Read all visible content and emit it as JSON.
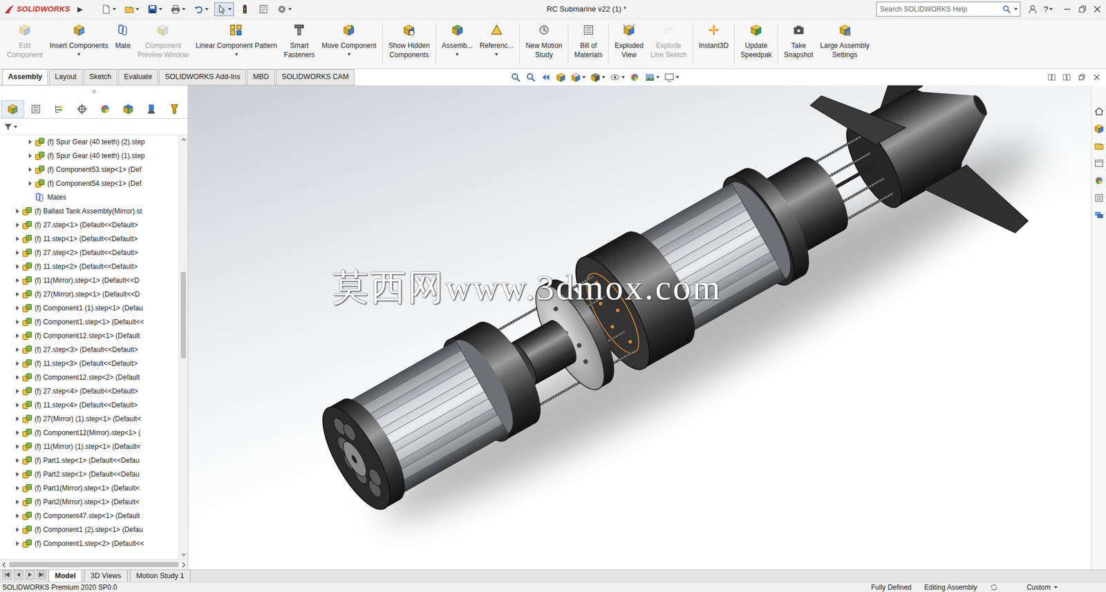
{
  "window": {
    "title": "RC Submarine v22 (1) *",
    "app": "SOLIDWORKS"
  },
  "title_bar": {
    "menu_arrow": "▶",
    "quick_access": [
      {
        "pressed": false
      },
      {
        "pressed": false
      },
      {
        "pressed": false
      },
      {
        "pressed": false
      },
      {
        "pressed": false
      },
      {
        "pressed": true
      },
      {
        "pressed": false
      },
      {
        "pressed": false
      },
      {
        "pressed": false
      }
    ],
    "search": {
      "placeholder": "Search SOLIDWORKS Help"
    },
    "help": "?"
  },
  "ribbon": [
    {
      "lines": [
        "Edit",
        "Component"
      ],
      "disabled": true,
      "separator_after": false
    },
    {
      "lines": [
        "Insert Components"
      ],
      "arrow": "▾",
      "disabled": false,
      "separator_after": false
    },
    {
      "lines": [
        "Mate"
      ],
      "disabled": false,
      "separator_after": false
    },
    {
      "lines": [
        "Component",
        "Preview Window"
      ],
      "disabled": true,
      "separator_after": false
    },
    {
      "lines": [
        "Linear Component Pattern"
      ],
      "arrow": "▾",
      "disabled": false,
      "separator_after": false
    },
    {
      "lines": [
        "Smart",
        "Fasteners"
      ],
      "disabled": false,
      "separator_after": false
    },
    {
      "lines": [
        "Move Component"
      ],
      "arrow": "▾",
      "disabled": false,
      "separator_after": true
    },
    {
      "lines": [
        "Show Hidden",
        "Components"
      ],
      "disabled": false,
      "separator_after": true
    },
    {
      "lines": [
        "Assemb..."
      ],
      "arrow": "▾",
      "disabled": false,
      "separator_after": false
    },
    {
      "lines": [
        "Referenc..."
      ],
      "arrow": "▾",
      "disabled": false,
      "separator_after": true
    },
    {
      "lines": [
        "New Motion",
        "Study"
      ],
      "disabled": false,
      "separator_after": true
    },
    {
      "lines": [
        "Bill of",
        "Materials"
      ],
      "disabled": false,
      "separator_after": true
    },
    {
      "lines": [
        "Exploded",
        "View"
      ],
      "disabled": false,
      "separator_after": false
    },
    {
      "lines": [
        "Explode",
        "Line Sketch"
      ],
      "disabled": true,
      "separator_after": true
    },
    {
      "lines": [
        "Instant3D"
      ],
      "disabled": false,
      "separator_after": true
    },
    {
      "lines": [
        "Update",
        "Speedpak"
      ],
      "disabled": false,
      "separator_after": true
    },
    {
      "lines": [
        "Take",
        "Snapshot"
      ],
      "disabled": false,
      "separator_after": false
    },
    {
      "lines": [
        "Large Assembly",
        "Settings"
      ],
      "disabled": false,
      "separator_after": false
    }
  ],
  "tabs": [
    {
      "label": "Assembly",
      "selected": true
    },
    {
      "label": "Layout",
      "selected": false
    },
    {
      "label": "Sketch",
      "selected": false
    },
    {
      "label": "Evaluate",
      "selected": false
    },
    {
      "label": "SOLIDWORKS Add-Ins",
      "selected": false
    },
    {
      "label": "MBD",
      "selected": false
    },
    {
      "label": "SOLIDWORKS CAM",
      "selected": false
    }
  ],
  "panel": {
    "tabs": [
      {
        "selected": true
      },
      {
        "selected": false
      },
      {
        "selected": false
      },
      {
        "selected": false
      },
      {
        "selected": false
      },
      {
        "selected": false
      },
      {
        "selected": false
      },
      {
        "selected": false
      }
    ],
    "tree": [
      {
        "label": "(f) Spur Gear (40 teeth) (2).step",
        "kind": "assembly",
        "depth": 1,
        "expanded": false
      },
      {
        "label": "(f) Spur Gear (40 teeth) (1).step",
        "kind": "assembly",
        "depth": 1,
        "expanded": false
      },
      {
        "label": "(f) Component53.step<1> (Def",
        "kind": "assembly",
        "depth": 1,
        "expanded": false
      },
      {
        "label": "(f) Component54.step<1> (Def",
        "kind": "assembly",
        "depth": 1,
        "expanded": false
      },
      {
        "label": "Mates",
        "kind": "mates",
        "depth": 1
      },
      {
        "label": "(f) Ballast Tank Assembly(Mirror).st",
        "kind": "assembly",
        "depth": 0,
        "expanded": false
      },
      {
        "label": "(f) 27.step<1> (Default<<Default>",
        "kind": "assembly",
        "depth": 0,
        "expanded": false
      },
      {
        "label": "(f) 11.step<1> (Default<<Default>",
        "kind": "assembly",
        "depth": 0,
        "expanded": false
      },
      {
        "label": "(f) 27.step<2> (Default<<Default>",
        "kind": "assembly",
        "depth": 0,
        "expanded": false
      },
      {
        "label": "(f) 11.step<2> (Default<<Default>",
        "kind": "assembly",
        "depth": 0,
        "expanded": false
      },
      {
        "label": "(f) 11(Mirror).step<1> (Default<<D",
        "kind": "assembly",
        "depth": 0,
        "expanded": false
      },
      {
        "label": "(f) 27(Mirror).step<1> (Default<<D",
        "kind": "assembly",
        "depth": 0,
        "expanded": false
      },
      {
        "label": "(f) Component1 (1).step<1> (Defau",
        "kind": "assembly",
        "depth": 0,
        "expanded": false
      },
      {
        "label": "(f) Component1.step<1> (Default<<",
        "kind": "assembly",
        "depth": 0,
        "expanded": false
      },
      {
        "label": "(f) Component12.step<1> (Default",
        "kind": "assembly",
        "depth": 0,
        "expanded": false
      },
      {
        "label": "(f) 27.step<3> (Default<<Default>",
        "kind": "assembly",
        "depth": 0,
        "expanded": false
      },
      {
        "label": "(f) 11.step<3> (Default<<Default>",
        "kind": "assembly",
        "depth": 0,
        "expanded": false
      },
      {
        "label": "(f) Component12.step<2> (Default",
        "kind": "assembly",
        "depth": 0,
        "expanded": false
      },
      {
        "label": "(f) 27.step<4> (Default<<Default>",
        "kind": "assembly",
        "depth": 0,
        "expanded": false
      },
      {
        "label": "(f) 11.step<4> (Default<<Default>",
        "kind": "assembly",
        "depth": 0,
        "expanded": false
      },
      {
        "label": "(f) 27(Mirror) (1).step<1> (Default<",
        "kind": "assembly",
        "depth": 0,
        "expanded": false
      },
      {
        "label": "(f) Component12(Mirror).step<1> (",
        "kind": "assembly",
        "depth": 0,
        "expanded": false
      },
      {
        "label": "(f) 11(Mirror) (1).step<1> (Default<",
        "kind": "assembly",
        "depth": 0,
        "expanded": false
      },
      {
        "label": "(f) Part1.step<1> (Default<<Defau",
        "kind": "assembly",
        "depth": 0,
        "expanded": false
      },
      {
        "label": "(f) Part2.step<1> (Default<<Defau",
        "kind": "assembly",
        "depth": 0,
        "expanded": false
      },
      {
        "label": "(f) Part1(Mirror).step<1> (Default<",
        "kind": "assembly",
        "depth": 0,
        "expanded": false
      },
      {
        "label": "(f) Part2(Mirror).step<1> (Default<",
        "kind": "assembly",
        "depth": 0,
        "expanded": false
      },
      {
        "label": "(f) Component47.step<1> (Default",
        "kind": "assembly",
        "depth": 0,
        "expanded": false
      },
      {
        "label": "(f) Component1 (2).step<1> (Defau",
        "kind": "assembly",
        "depth": 0,
        "expanded": false
      },
      {
        "label": "(f) Component1.step<2> (Default<<",
        "kind": "assembly",
        "depth": 0,
        "expanded": false
      }
    ],
    "vscroll": {
      "level": 0.4
    }
  },
  "graphics": {
    "watermark": "莫西网www.3dmox.com"
  },
  "bottom_tabs": [
    {
      "label": "Model",
      "selected": true
    },
    {
      "label": "3D Views",
      "selected": false
    },
    {
      "label": "Motion Study 1",
      "selected": false
    }
  ],
  "status_bar": {
    "product": "SOLIDWORKS Premium 2020 SP0.0",
    "items": [
      "Fully Defined",
      "Editing Assembly",
      "Custom"
    ]
  }
}
